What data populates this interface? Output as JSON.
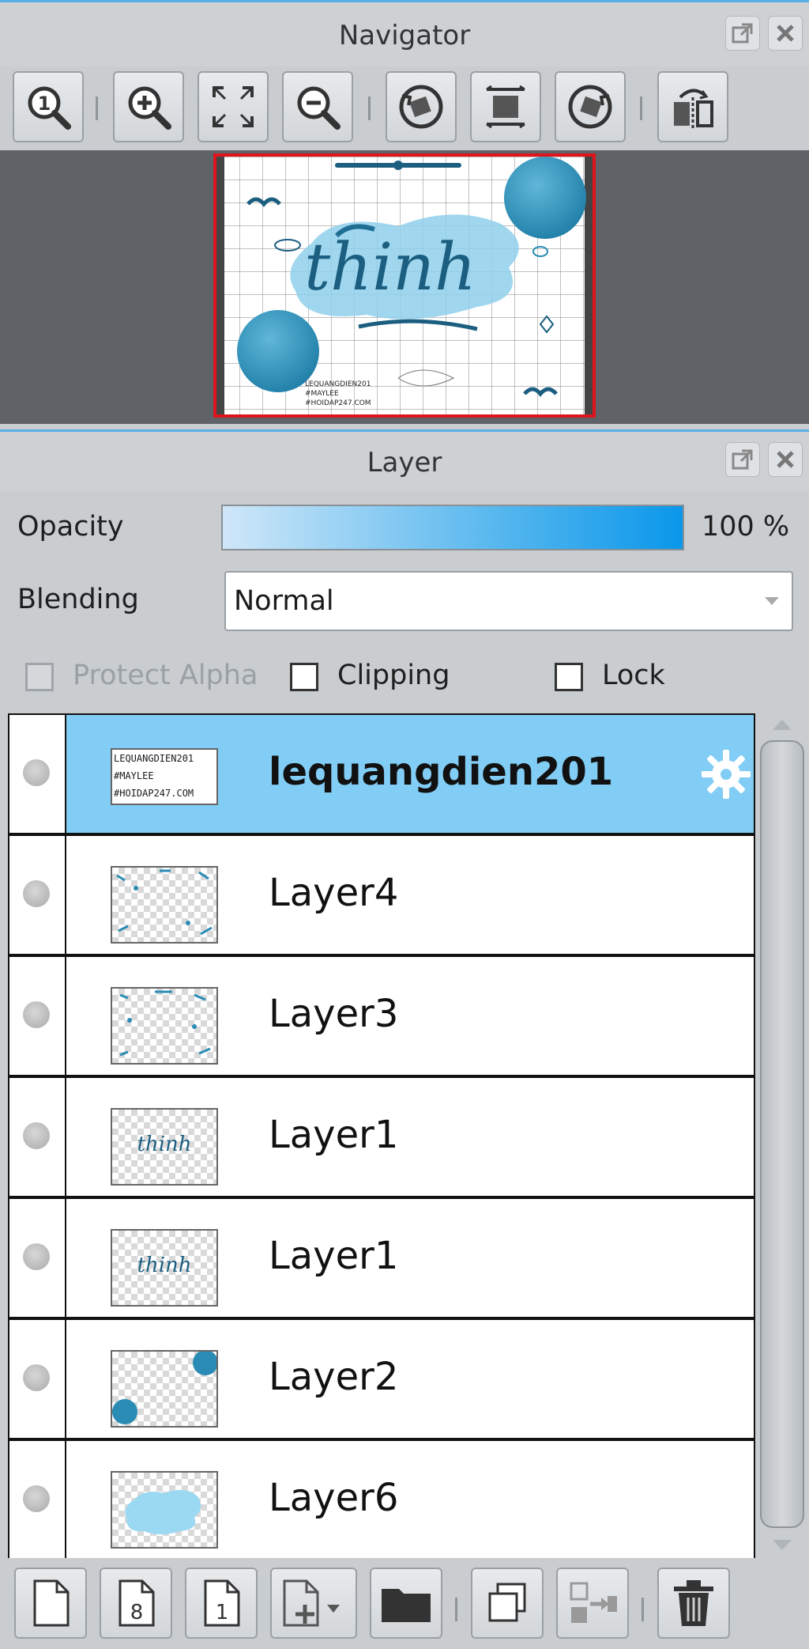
{
  "navigator": {
    "title": "Navigator",
    "preview": {
      "artwork_text": "thinh",
      "credit_lines": [
        "LEQUANGDIEN201",
        "#MAYLEE",
        "#HOIDAP247.COM"
      ]
    }
  },
  "layer_panel": {
    "title": "Layer",
    "opacity_label": "Opacity",
    "opacity_value": "100 %",
    "opacity_fraction": 1.0,
    "blending_label": "Blending",
    "blending_value": "Normal",
    "protect_alpha_label": "Protect Alpha",
    "clipping_label": "Clipping",
    "lock_label": "Lock",
    "layers": [
      {
        "name": "lequangdien201",
        "selected": true,
        "thumb_lines": [
          "LEQUANGDIEN201",
          "#MAYLEE",
          "#HOIDAP247.COM"
        ]
      },
      {
        "name": "Layer4",
        "selected": false
      },
      {
        "name": "Layer3",
        "selected": false
      },
      {
        "name": "Layer1",
        "selected": false,
        "thumb_text": "thinh"
      },
      {
        "name": "Layer1",
        "selected": false,
        "thumb_text": "thinh"
      },
      {
        "name": "Layer2",
        "selected": false
      },
      {
        "name": "Layer6",
        "selected": false
      }
    ]
  },
  "colors": {
    "accent": "#5ab0e6",
    "selected_row": "#82cdf5",
    "preview_border": "#e0141c",
    "artwork_blue": "#2a8cb4"
  },
  "icons": {
    "navigator_toolbar": [
      "zoom-actual-icon",
      "zoom-in-icon",
      "fit-screen-icon",
      "zoom-out-icon",
      "rotate-left-icon",
      "reset-rotation-icon",
      "rotate-right-icon",
      "flip-horizontal-icon"
    ],
    "layer_toolbar": [
      "new-layer-icon",
      "new-8bit-layer-icon",
      "new-1bit-layer-icon",
      "add-layer-menu-icon",
      "new-folder-icon",
      "duplicate-layer-icon",
      "merge-down-icon",
      "delete-layer-icon"
    ]
  }
}
